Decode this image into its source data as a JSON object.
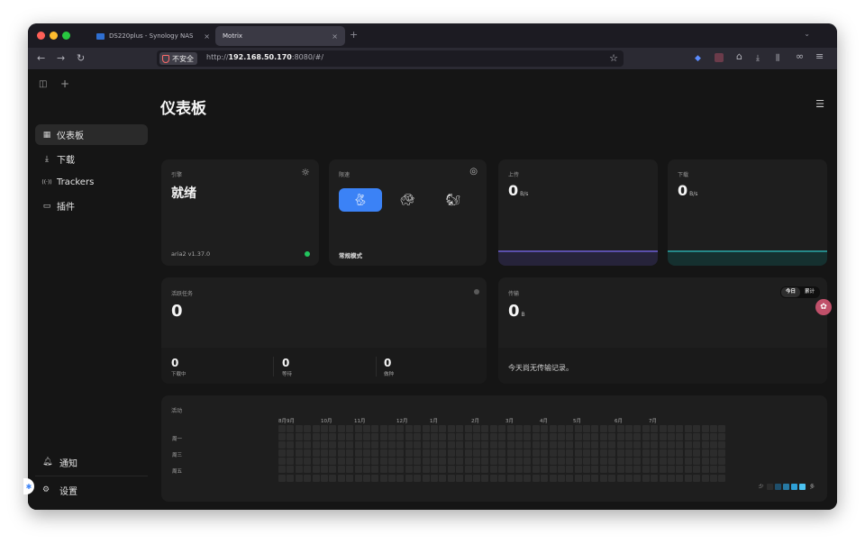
{
  "browser": {
    "tabs": [
      {
        "label": "DS220plus - Synology NAS",
        "close": "×"
      },
      {
        "label": "Motrix",
        "close": "×"
      }
    ],
    "new_tab": "+",
    "tab_menu": "⌄",
    "nav": {
      "back": "←",
      "forward": "→",
      "reload": "↻"
    },
    "insecure_label": "不安全",
    "url_prefix": "http://",
    "url_host": "192.168.50.170",
    "url_rest": ":8080/#/",
    "bookmark_star": "☆",
    "toolbar_icons": {
      "extension_shield": "◆",
      "home": "⌂",
      "download": "⤓",
      "library": "⫼",
      "sync": "∞",
      "menu": "≡"
    }
  },
  "sidebar": {
    "tools": {
      "panel_toggle": "◫",
      "add": "+"
    },
    "items": [
      {
        "label": "仪表板",
        "icon": "▦"
      },
      {
        "label": "下载",
        "icon": "⤓"
      },
      {
        "label": "Trackers",
        "icon": "((·))"
      },
      {
        "label": "插件",
        "icon": "▭"
      }
    ],
    "footer": [
      {
        "label": "通知",
        "icon": "🔔︎"
      },
      {
        "label": "设置",
        "icon": "⚙"
      }
    ]
  },
  "page": {
    "title": "仪表板",
    "filter_icon": "☰"
  },
  "engine": {
    "label": "引擎",
    "status": "就绪",
    "version": "aria2 v1.37.0",
    "icon": "☼",
    "status_color": "#22c55e"
  },
  "speed_mode": {
    "label": "限速",
    "mode_name": "常规模式",
    "icon": "◎",
    "modes": [
      "🐇︎",
      "🐢︎",
      "🐿︎"
    ]
  },
  "upload": {
    "label": "上传",
    "value": "0",
    "unit": "B/s",
    "line_color": "#6d5fd3"
  },
  "download": {
    "label": "下载",
    "value": "0",
    "unit": "B/s",
    "line_color": "#2aa7a7"
  },
  "active_tasks": {
    "label": "活跃任务",
    "value": "0",
    "stats": [
      {
        "value": "0",
        "label": "下载中"
      },
      {
        "value": "0",
        "label": "等待"
      },
      {
        "value": "0",
        "label": "做种"
      }
    ]
  },
  "transfer": {
    "label": "传输",
    "value": "0",
    "unit": "B",
    "segments": [
      "今日",
      "累计"
    ],
    "empty_message": "今天尚无传输记录。"
  },
  "activity": {
    "label": "活动",
    "months": [
      "8月9月",
      "10月",
      "11月",
      "12月",
      "1月",
      "2月",
      "3月",
      "4月",
      "5月",
      "6月",
      "7月"
    ],
    "weekdays": [
      "周一",
      "周三",
      "周五"
    ],
    "legend_less": "少",
    "legend_more": "多",
    "cell_color": "#2c2c2c",
    "legend_colors": [
      "#2c2c2c",
      "#1f4f6b",
      "#2779a3",
      "#2e9fd6",
      "#4cc3f2"
    ]
  },
  "floating": {
    "assistant_icon": "✿",
    "edge_icon": "✱"
  }
}
